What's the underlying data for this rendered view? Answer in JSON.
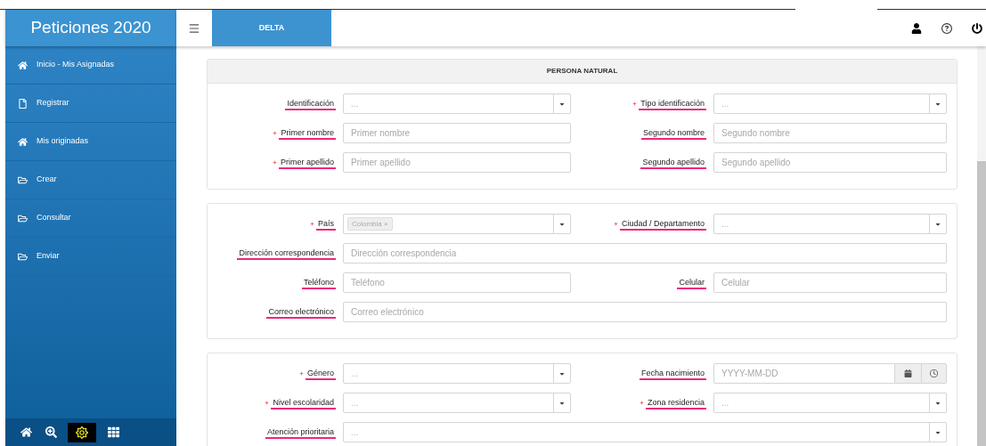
{
  "app_title": "Peticiones 2020",
  "sidebar": {
    "items": [
      {
        "label": "Inicio - Mis Asignadas",
        "kind": "home"
      },
      {
        "label": "Registrar",
        "kind": "file"
      },
      {
        "label": "Mis originadas",
        "kind": "home"
      },
      {
        "label": "Crear",
        "kind": "folder"
      },
      {
        "label": "Consultar",
        "kind": "folder"
      },
      {
        "label": "Enviar",
        "kind": "folder"
      }
    ],
    "toolbar": [
      {
        "kind": "home",
        "selected": false
      },
      {
        "kind": "zoom",
        "selected": false
      },
      {
        "kind": "sun",
        "selected": true
      },
      {
        "kind": "grid",
        "selected": false
      }
    ]
  },
  "tabs": [
    {
      "label": "DELTA",
      "selected": true
    }
  ],
  "sections": [
    {
      "title": "PERSONA NATURAL",
      "fields": [
        {
          "label": "Identificación",
          "required": false,
          "kind": "select",
          "placeholder": "...",
          "wide": false
        },
        {
          "label": "Tipo identificación",
          "required": true,
          "kind": "select",
          "placeholder": "...",
          "wide": false
        },
        {
          "label": "Primer nombre",
          "required": true,
          "kind": "text",
          "placeholder": "Primer nombre",
          "wide": false
        },
        {
          "label": "Segundo nombre",
          "required": false,
          "kind": "text",
          "placeholder": "Segundo nombre",
          "wide": false
        },
        {
          "label": "Primer apellido",
          "required": true,
          "kind": "text",
          "placeholder": "Primer apellido",
          "wide": false
        },
        {
          "label": "Segundo apellido",
          "required": false,
          "kind": "text",
          "placeholder": "Segundo apellido",
          "wide": false
        }
      ]
    },
    {
      "fields": [
        {
          "label": "País",
          "required": true,
          "kind": "tags",
          "tags": [
            "Colombia ×"
          ],
          "wide": false
        },
        {
          "label": "Ciudad / Departamento",
          "required": true,
          "kind": "select",
          "placeholder": "...",
          "wide": false
        },
        {
          "label": "Dirección correspondencia",
          "required": false,
          "kind": "text",
          "placeholder": "Dirección correspondencia",
          "wide": true
        },
        {
          "label": "Teléfono",
          "required": false,
          "kind": "text",
          "placeholder": "Teléfono",
          "wide": false
        },
        {
          "label": "Celular",
          "required": false,
          "kind": "text",
          "placeholder": "Celular",
          "wide": false
        },
        {
          "label": "Correo electrónico",
          "required": false,
          "kind": "text",
          "placeholder": "Correo electrónico",
          "wide": true
        }
      ]
    },
    {
      "fields": [
        {
          "label": "Género",
          "required": true,
          "kind": "select",
          "placeholder": "...",
          "wide": false
        },
        {
          "label": "Fecha nacimiento",
          "required": false,
          "kind": "date",
          "placeholder": "YYYY-MM-DD",
          "wide": false
        },
        {
          "label": "Nivel escolaridad",
          "required": true,
          "kind": "select",
          "placeholder": "...",
          "wide": false
        },
        {
          "label": "Zona residencia",
          "required": true,
          "kind": "select",
          "placeholder": "...",
          "wide": false
        },
        {
          "label": "Atención prioritaria",
          "required": false,
          "kind": "select",
          "placeholder": "...",
          "wide": true
        }
      ]
    }
  ]
}
